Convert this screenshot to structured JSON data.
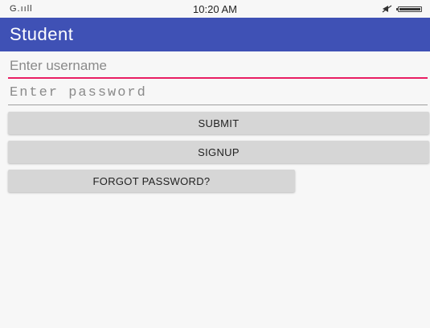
{
  "status_bar": {
    "signal": "G.ııll",
    "time": "10:20 AM",
    "icons": [
      "signal-icon",
      "mute-icon",
      "battery-icon"
    ]
  },
  "app_bar": {
    "title": "Student",
    "color": "#3f51b5"
  },
  "form": {
    "username": {
      "value": "",
      "placeholder": "Enter username"
    },
    "password": {
      "value": "",
      "placeholder": "Enter password"
    },
    "submit_label": "SUBMIT",
    "signup_label": "SIGNUP",
    "forgot_label": "FORGOT PASSWORD?"
  },
  "colors": {
    "accent": "#e91e63",
    "button": "#d6d6d6",
    "background": "#f7f7f7"
  }
}
